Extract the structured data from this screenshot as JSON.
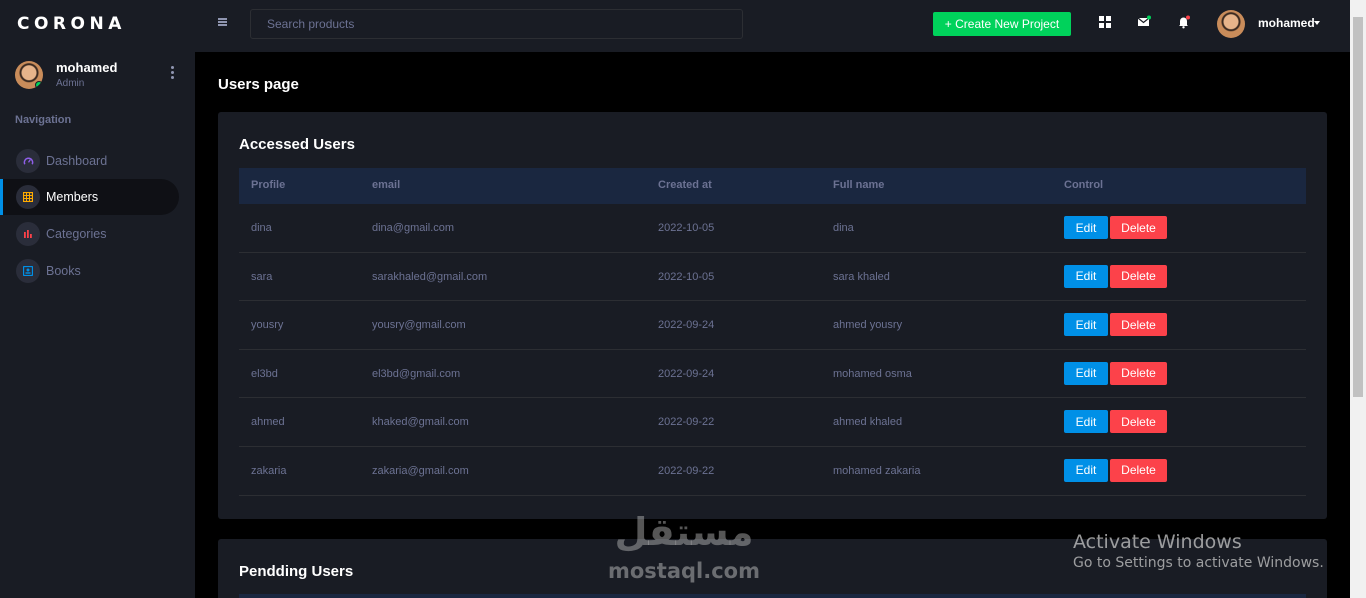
{
  "brand": "CORONA",
  "sidebar": {
    "profile": {
      "name": "mohamed",
      "role": "Admin"
    },
    "nav_heading": "Navigation",
    "items": [
      {
        "label": "Dashboard",
        "icon": "speedometer-icon",
        "color": "#8f5fe8"
      },
      {
        "label": "Members",
        "icon": "table-icon",
        "color": "#ffab00",
        "active": true
      },
      {
        "label": "Categories",
        "icon": "chart-bar-icon",
        "color": "#fc424a"
      },
      {
        "label": "Books",
        "icon": "contacts-icon",
        "color": "#0090e7"
      }
    ]
  },
  "topbar": {
    "search_placeholder": "Search products",
    "create_button": "+ Create New Project",
    "user": "mohamed"
  },
  "page_title": "Users page",
  "accessed": {
    "title": "Accessed Users",
    "columns": [
      "Profile",
      "email",
      "Created at",
      "Full name",
      "Control"
    ],
    "rows": [
      {
        "profile": "dina",
        "email": "dina@gmail.com",
        "created": "2022-10-05",
        "full_name": "dina"
      },
      {
        "profile": "sara",
        "email": "sarakhaled@gmail.com",
        "created": "2022-10-05",
        "full_name": "sara khaled"
      },
      {
        "profile": "yousry",
        "email": "yousry@gmail.com",
        "created": "2022-09-24",
        "full_name": "ahmed yousry"
      },
      {
        "profile": "el3bd",
        "email": "el3bd@gmail.com",
        "created": "2022-09-24",
        "full_name": "mohamed osma"
      },
      {
        "profile": "ahmed",
        "email": "khaked@gmail.com",
        "created": "2022-09-22",
        "full_name": "ahmed khaled"
      },
      {
        "profile": "zakaria",
        "email": "zakaria@gmail.com",
        "created": "2022-09-22",
        "full_name": "mohamed zakaria"
      }
    ],
    "edit_label": "Edit",
    "delete_label": "Delete"
  },
  "pending": {
    "title": "Pendding Users"
  },
  "watermark": {
    "arabic": "مستقل",
    "latin": "mostaql.com",
    "activate_title": "Activate Windows",
    "activate_sub": "Go to Settings to activate Windows."
  }
}
